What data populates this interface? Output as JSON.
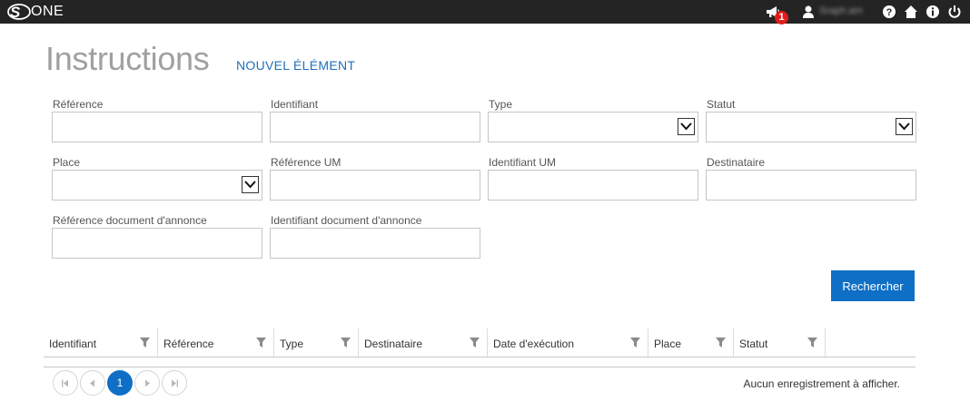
{
  "topbar": {
    "logo_text": "ONE",
    "notification_count": "1",
    "username": "Sraph.am"
  },
  "page": {
    "title": "Instructions",
    "new_item": "NOUVEL ÉLÉMENT"
  },
  "form": {
    "fields": [
      {
        "label": "Référence",
        "type": "text",
        "value": ""
      },
      {
        "label": "Identifiant",
        "type": "text",
        "value": ""
      },
      {
        "label": "Type",
        "type": "select",
        "value": ""
      },
      {
        "label": "Statut",
        "type": "select",
        "value": ""
      },
      {
        "label": "Place",
        "type": "select",
        "value": ""
      },
      {
        "label": "Référence UM",
        "type": "text",
        "value": ""
      },
      {
        "label": "Identifiant UM",
        "type": "text",
        "value": ""
      },
      {
        "label": "Destinataire",
        "type": "text",
        "value": ""
      },
      {
        "label": "Référence document d'annonce",
        "type": "text",
        "value": ""
      },
      {
        "label": "Identifiant document d'annonce",
        "type": "text",
        "value": ""
      }
    ],
    "search_label": "Rechercher"
  },
  "grid": {
    "columns": [
      "Identifiant",
      "Référence",
      "Type",
      "Destinataire",
      "Date d'exécution",
      "Place",
      "Statut"
    ],
    "rows": [],
    "current_page": "1",
    "empty_message": "Aucun enregistrement à afficher."
  },
  "colors": {
    "topbar": "#242424",
    "accent": "#0f6fc6",
    "link": "#1e6fbd",
    "badge": "#e21b1b"
  }
}
